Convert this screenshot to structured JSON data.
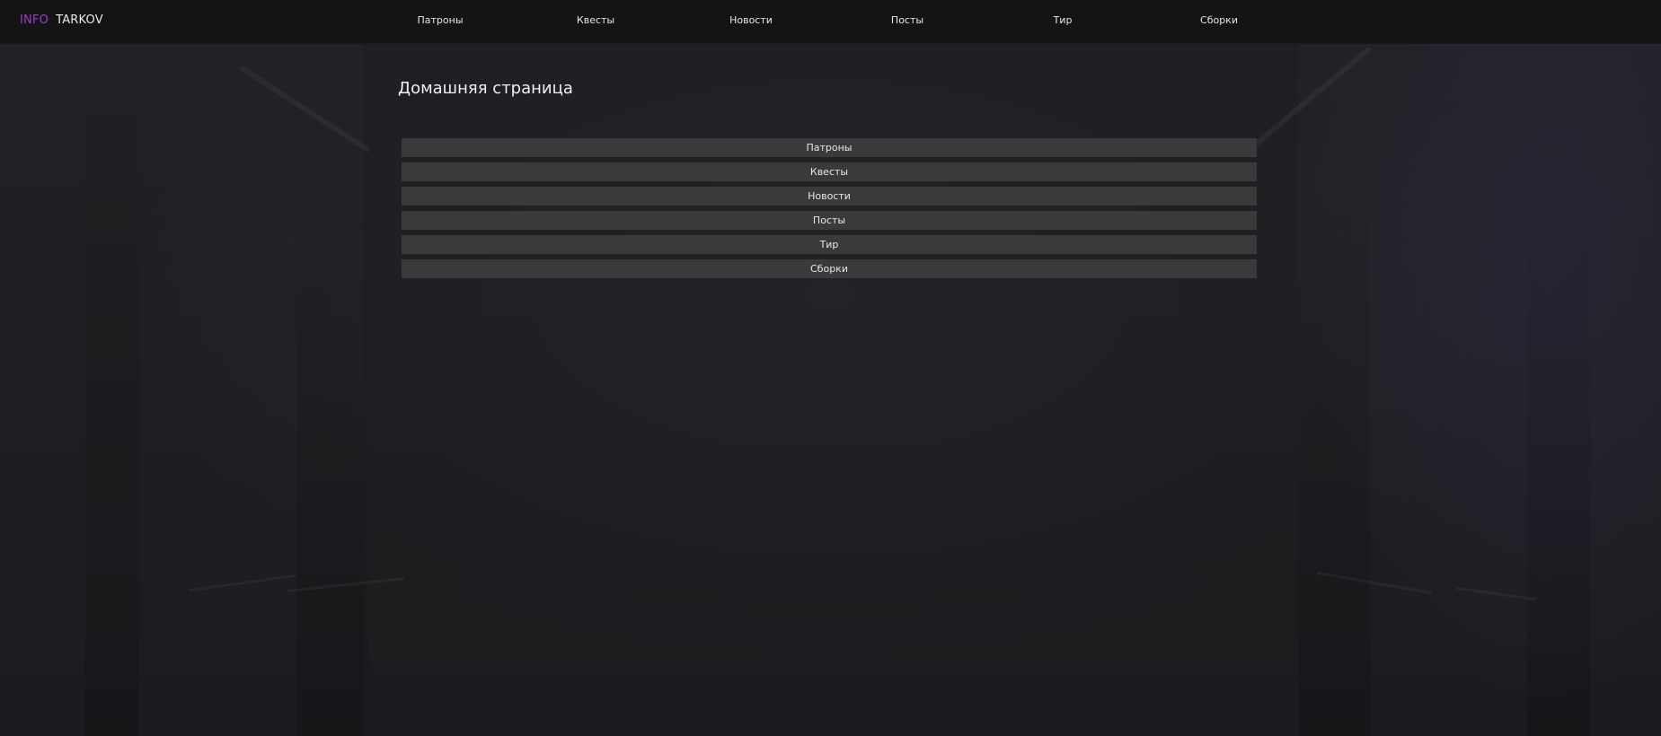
{
  "navbar": {
    "brand_accent": "INFO",
    "brand_main": "TARKOV",
    "items": [
      {
        "label": "Патроны"
      },
      {
        "label": "Квесты"
      },
      {
        "label": "Новости"
      },
      {
        "label": "Посты"
      },
      {
        "label": "Тир"
      },
      {
        "label": "Сборки"
      }
    ]
  },
  "main": {
    "title": "Домашняя страница",
    "menu": [
      {
        "label": "Патроны"
      },
      {
        "label": "Квесты"
      },
      {
        "label": "Новости"
      },
      {
        "label": "Посты"
      },
      {
        "label": "Тир"
      },
      {
        "label": "Сборки"
      }
    ]
  },
  "colors": {
    "brand_accent": "#a23bcc",
    "navbar_bg": "#141414",
    "button_bg": "#3a3a3a",
    "page_bg": "#1f1f23",
    "text": "#e8e8e8"
  }
}
